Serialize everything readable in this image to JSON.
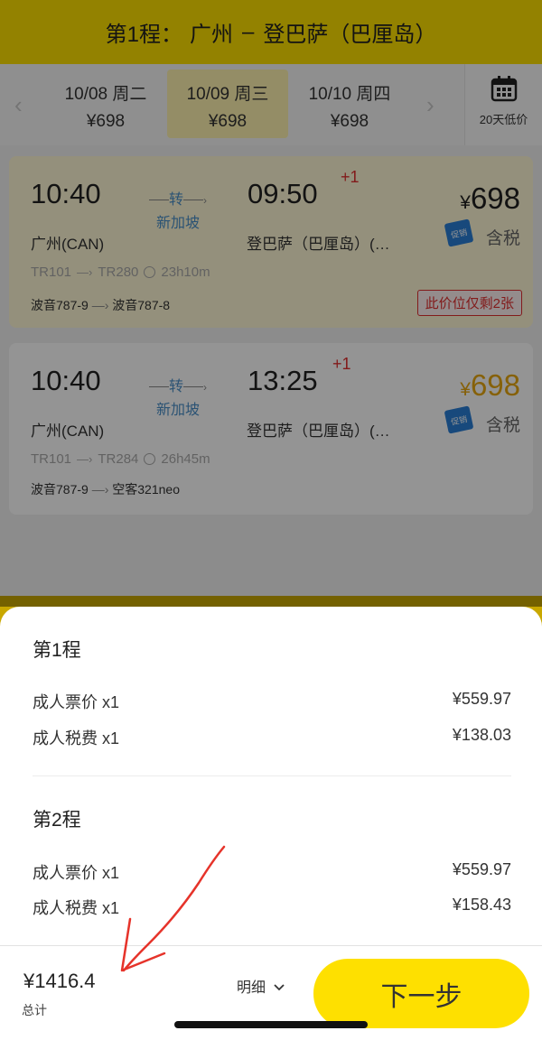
{
  "header": {
    "segment": "第1程：",
    "origin": "广州",
    "separator": "–",
    "destination": "登巴萨（巴厘岛）"
  },
  "date_bar": {
    "dates": [
      {
        "date": "10/08",
        "weekday": "周二",
        "price": "¥698"
      },
      {
        "date": "10/09",
        "weekday": "周三",
        "price": "¥698"
      },
      {
        "date": "10/10",
        "weekday": "周四",
        "price": "¥698"
      }
    ],
    "selected_index": 1,
    "calendar_label": "20天低价"
  },
  "flights": [
    {
      "dep_time": "10:40",
      "transfer": "转",
      "via": "新加坡",
      "arr_time": "09:50",
      "next_day": "+1",
      "price_symbol": "¥",
      "price": "698",
      "promo": "促销",
      "tax_label": "含税",
      "dep_airport": "广州(CAN)",
      "arr_airport": "登巴萨（巴厘岛）(…",
      "flight1": "TR101",
      "flight2": "TR280",
      "duration": "23h10m",
      "aircraft1": "波音787-9",
      "aircraft2": "波音787-8",
      "seats_left": "此价位仅剩2张"
    },
    {
      "dep_time": "10:40",
      "transfer": "转",
      "via": "新加坡",
      "arr_time": "13:25",
      "next_day": "+1",
      "price_symbol": "¥",
      "price": "698",
      "promo": "促销",
      "tax_label": "含税",
      "dep_airport": "广州(CAN)",
      "arr_airport": "登巴萨（巴厘岛）(…",
      "flight1": "TR101",
      "flight2": "TR284",
      "duration": "26h45m",
      "aircraft1": "波音787-9",
      "aircraft2": "空客321neo"
    }
  ],
  "sheet": {
    "legs": [
      {
        "title": "第1程",
        "rows": [
          {
            "label": "成人票价 x1",
            "value": "¥559.97"
          },
          {
            "label": "成人税费 x1",
            "value": "¥138.03"
          }
        ]
      },
      {
        "title": "第2程",
        "rows": [
          {
            "label": "成人票价 x1",
            "value": "¥559.97"
          },
          {
            "label": "成人税费 x1",
            "value": "¥158.43"
          }
        ]
      }
    ]
  },
  "footer": {
    "total": "¥1416.4",
    "total_label": "总计",
    "detail_label": "明细",
    "next_label": "下一步"
  },
  "colors": {
    "brand_yellow": "#fee000",
    "promo_blue": "#2a7fd6",
    "alert_red": "#e03030",
    "annotation_red": "#e6332a",
    "price_gold": "#e7a710"
  }
}
